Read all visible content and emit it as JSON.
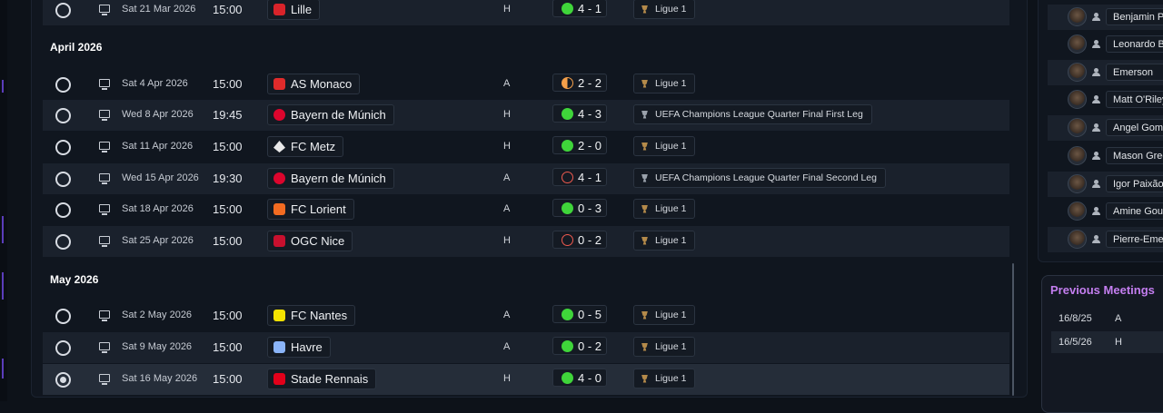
{
  "fixtures": {
    "months": [
      "April 2026",
      "May 2026"
    ],
    "matches": [
      {
        "date": "Sat 21 Mar 2026",
        "time": "15:00",
        "opponent": "Lille",
        "venue": "H",
        "result": "4 - 1",
        "outcome": "win",
        "competition": "Ligue 1",
        "crest_color": "#d8232a"
      },
      {
        "date": "Sat 4 Apr 2026",
        "time": "15:00",
        "opponent": "AS Monaco",
        "venue": "A",
        "result": "2 - 2",
        "outcome": "draw",
        "competition": "Ligue 1",
        "crest_color": "#e02b2b"
      },
      {
        "date": "Wed 8 Apr 2026",
        "time": "19:45",
        "opponent": "Bayern de Múnich",
        "venue": "H",
        "result": "4 - 3",
        "outcome": "win",
        "competition": "UEFA Champions League Quarter Final First Leg",
        "crest_color": "#dc052d"
      },
      {
        "date": "Sat 11 Apr 2026",
        "time": "15:00",
        "opponent": "FC Metz",
        "venue": "H",
        "result": "2 - 0",
        "outcome": "win",
        "competition": "Ligue 1",
        "crest_color": "#e9e9e9"
      },
      {
        "date": "Wed 15 Apr 2026",
        "time": "19:30",
        "opponent": "Bayern de Múnich",
        "venue": "A",
        "result": "4 - 1",
        "outcome": "loss",
        "competition": "UEFA Champions League Quarter Final Second Leg",
        "crest_color": "#dc052d"
      },
      {
        "date": "Sat 18 Apr 2026",
        "time": "15:00",
        "opponent": "FC Lorient",
        "venue": "A",
        "result": "0 - 3",
        "outcome": "win",
        "competition": "Ligue 1",
        "crest_color": "#f26b21"
      },
      {
        "date": "Sat 25 Apr 2026",
        "time": "15:00",
        "opponent": "OGC Nice",
        "venue": "H",
        "result": "0 - 2",
        "outcome": "loss",
        "competition": "Ligue 1",
        "crest_color": "#c8102e"
      },
      {
        "date": "Sat 2 May 2026",
        "time": "15:00",
        "opponent": "FC Nantes",
        "venue": "A",
        "result": "0 - 5",
        "outcome": "win",
        "competition": "Ligue 1",
        "crest_color": "#f3e200"
      },
      {
        "date": "Sat 9 May 2026",
        "time": "15:00",
        "opponent": "Havre",
        "venue": "A",
        "result": "0 - 2",
        "outcome": "win",
        "competition": "Ligue 1",
        "crest_color": "#8ab4f8"
      },
      {
        "date": "Sat 16 May 2026",
        "time": "15:00",
        "opponent": "Stade Rennais",
        "venue": "H",
        "result": "4 - 0",
        "outcome": "win",
        "competition": "Ligue 1",
        "crest_color": "#e2001a"
      }
    ]
  },
  "squad": {
    "players": [
      "Benjamin P",
      "Leonardo B",
      "Emerson",
      "Matt O'Riley",
      "Angel Gome",
      "Mason Gree",
      "Igor Paixão",
      "Amine Goui",
      "Pierre-Emer"
    ]
  },
  "previous_meetings": {
    "title": "Previous Meetings",
    "rows": [
      {
        "date": "16/8/25",
        "venue": "A"
      },
      {
        "date": "16/5/26",
        "venue": "H"
      }
    ]
  },
  "colors": {
    "win": "#3fd53a",
    "draw": "#f5a04a",
    "loss": "#ef5a4f",
    "accent": "#c47ef0"
  }
}
